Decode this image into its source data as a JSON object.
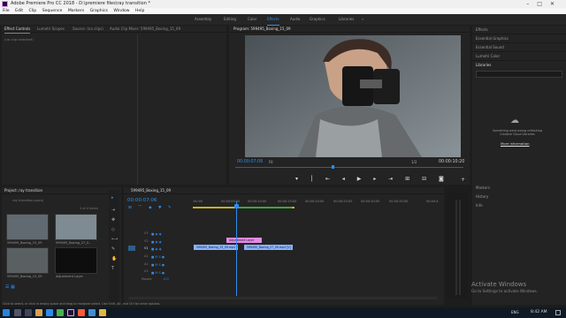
{
  "window": {
    "title": "Adobe Premiere Pro CC 2018 - D:\\premiere files\\ray transition *"
  },
  "menu": [
    "File",
    "Edit",
    "Clip",
    "Sequence",
    "Markers",
    "Graphics",
    "Window",
    "Help"
  ],
  "workspaces": [
    "Assembly",
    "Editing",
    "Color",
    "Effects",
    "Audio",
    "Graphics",
    "Libraries"
  ],
  "active_workspace": "Effects",
  "source_panel": {
    "tabs": [
      "Effect Controls",
      "Lumetri Scopes",
      "Source: (no clips)",
      "Audio Clip Mixer: 599495_Boxing_15_09"
    ],
    "empty_text": "(no clip selected)"
  },
  "program": {
    "tab": "Program: 599495_Boxing_15_09",
    "timecode": "00:00:07:06",
    "fit": "Fit",
    "quality": "1/2",
    "duration": "00:00:10:20"
  },
  "project": {
    "tabs": "Project: ray transition",
    "bin": "ray transition.prproj",
    "count": "1 of 4 items",
    "items": [
      "599495_Boxing_15_09",
      "599495_Boxing_27_0...",
      "599495_Boxing_15_09",
      "Adjustment Layer"
    ]
  },
  "sequence": {
    "tab": "599495_Boxing_15_09",
    "timecode": "00:00:07:06",
    "ruler": [
      ":00:00",
      "00:00:05:00",
      "00:00:10:00",
      "00:00:15:00",
      "00:00:20:00",
      "00:00:25:00",
      "00:00:30:00",
      "00:00:35:00",
      "00:00:4"
    ],
    "video_tracks": [
      "V3",
      "V2",
      "V1"
    ],
    "audio_tracks": [
      "A1",
      "A2",
      "A3"
    ],
    "master": "Master",
    "master_value": "0.0",
    "clips": {
      "adjustment": "Adjustment Layer",
      "clip1": "599495_Boxing_15_09.mp4 [V]",
      "clip2": "599495_Boxing_27_09.mp4 [V]"
    }
  },
  "right_panels": {
    "top": [
      "Effects",
      "Essential Graphics",
      "Essential Sound",
      "Lumetri Color",
      "Libraries"
    ],
    "libraries_msg": "Something went wrong refreshing Creative Cloud Libraries",
    "more_info": "More information",
    "bottom": [
      "Markers",
      "History",
      "Info"
    ]
  },
  "activate": {
    "title": "Activate Windows",
    "sub": "Go to Settings to activate Windows."
  },
  "status_hint": "Click to select, or click in empty space and drag to marquee select. Use Shift, Alt, and Ctrl for other options.",
  "system_tray": {
    "time": "8:42 AM",
    "lang": "ENG"
  },
  "colors": {
    "accent": "#2d8ceb",
    "clip_blue": "#8ab4ff",
    "clip_pink": "#e48adf",
    "playhead": "#2d8ceb"
  }
}
